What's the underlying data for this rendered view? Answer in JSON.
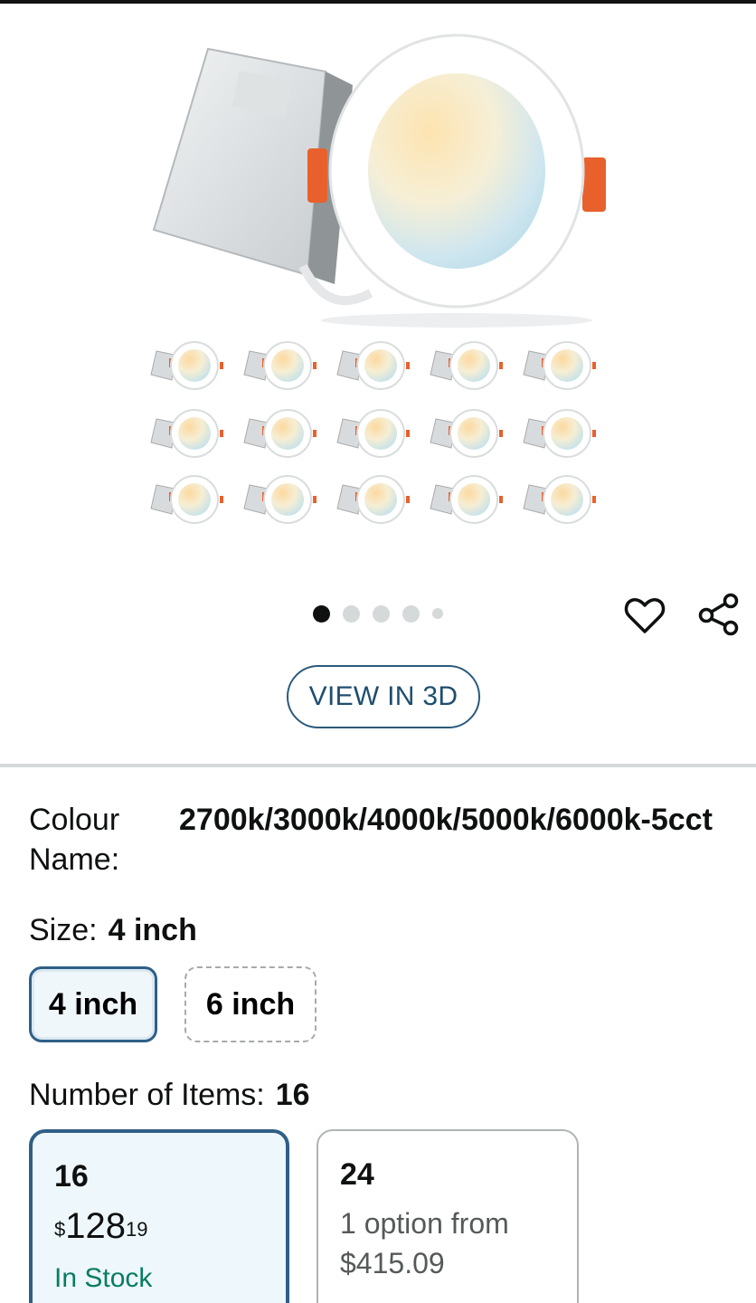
{
  "gallery": {
    "dot_count": 5,
    "active_dot": 0,
    "view_3d_label": "VIEW IN 3D"
  },
  "colour": {
    "label": "Colour Name:",
    "value": "2700k/3000k/4000k/5000k/6000k-5cct"
  },
  "size": {
    "label": "Size:",
    "selected": "4 inch",
    "options": [
      "4 inch",
      "6 inch"
    ]
  },
  "items": {
    "label": "Number of Items:",
    "selected": "16",
    "options": [
      {
        "qty": "16",
        "price_symbol": "$",
        "price_whole": "128",
        "price_cents": "19",
        "stock": "In Stock"
      },
      {
        "qty": "24",
        "option_text": "1 option from",
        "option_price": "$415.09"
      }
    ]
  },
  "colors": {
    "selected_border": "#2f5f86",
    "link_blue": "#1f4e6e",
    "stock_green": "#067d62"
  }
}
